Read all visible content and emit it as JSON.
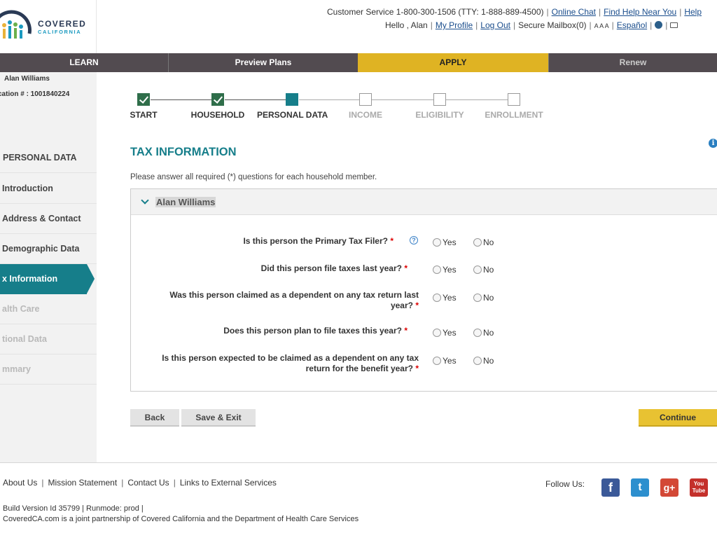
{
  "logo": {
    "line1": "COVERED",
    "line2": "CALIFORNIA"
  },
  "header": {
    "customer_service": "Customer Service 1-800-300-1506 (TTY: 1-888-889-4500)",
    "online_chat": "Online Chat",
    "find_help": "Find Help Near You",
    "help": "Help",
    "greeting": "Hello , Alan",
    "my_profile": "My Profile",
    "log_out": "Log Out",
    "secure_mailbox": "Secure Mailbox(0)",
    "font_sizes": "A A A",
    "espanol": "Español"
  },
  "nav": {
    "learn": "LEARN",
    "preview_plans": "Preview Plans",
    "apply": "APPLY",
    "renew": "Renew"
  },
  "sidebar": {
    "user_name": "Alan Williams",
    "application_number": "cation # : 1001840224",
    "section_title": "PERSONAL DATA",
    "items": [
      {
        "label": "Introduction"
      },
      {
        "label": "Address & Contact"
      },
      {
        "label": "Demographic Data"
      },
      {
        "label": "x Information"
      },
      {
        "label": "alth Care"
      },
      {
        "label": "tional Data"
      },
      {
        "label": "mmary"
      }
    ]
  },
  "progress": {
    "steps": [
      {
        "label": "START",
        "status": "done"
      },
      {
        "label": "HOUSEHOLD",
        "status": "done"
      },
      {
        "label": "PERSONAL DATA",
        "status": "current"
      },
      {
        "label": "INCOME",
        "status": "pending"
      },
      {
        "label": "ELIGIBILITY",
        "status": "pending"
      },
      {
        "label": "ENROLLMENT",
        "status": "pending"
      }
    ]
  },
  "main": {
    "title": "TAX INFORMATION",
    "instructions": "Please answer all required (*) questions for each household member.",
    "member_name": "Alan  Williams",
    "questions": [
      {
        "text": "Is this person the Primary Tax Filer?",
        "required": "*",
        "yes": "Yes",
        "no": "No"
      },
      {
        "text": "Did this person file taxes last year?",
        "required": "*",
        "yes": "Yes",
        "no": "No"
      },
      {
        "text_line1": "Was this person claimed as a dependent on any tax return last",
        "text_line2": "year?",
        "required": "*",
        "yes": "Yes",
        "no": "No"
      },
      {
        "text": "Does this person plan to file taxes this year?",
        "required": "*",
        "yes": "Yes",
        "no": "No"
      },
      {
        "text_line1": "Is this person expected to be claimed as a dependent on any tax",
        "text_line2": "return for the benefit year?",
        "required": "*",
        "yes": "Yes",
        "no": "No"
      }
    ],
    "help_glyph": "?",
    "info_glyph": "i"
  },
  "buttons": {
    "back": "Back",
    "save_exit": "Save & Exit",
    "continue": "Continue"
  },
  "footer": {
    "about": "About Us",
    "mission": "Mission Statement",
    "contact": "Contact Us",
    "links": "Links to External Services",
    "follow": "Follow Us:",
    "build": "Build Version Id 35799  |   Runmode: prod  |",
    "partnership": "CoveredCA.com is a joint partnership of Covered California and the Department of Health Care Services",
    "social": {
      "facebook": "f",
      "twitter": "t",
      "google": "g+",
      "youtube_l1": "You",
      "youtube_l2": "Tube"
    }
  },
  "colors": {
    "teal": "#167e8a",
    "apply_gold": "#dfb323",
    "nav_dark": "#524b50",
    "check_green": "#2f6e4a"
  }
}
